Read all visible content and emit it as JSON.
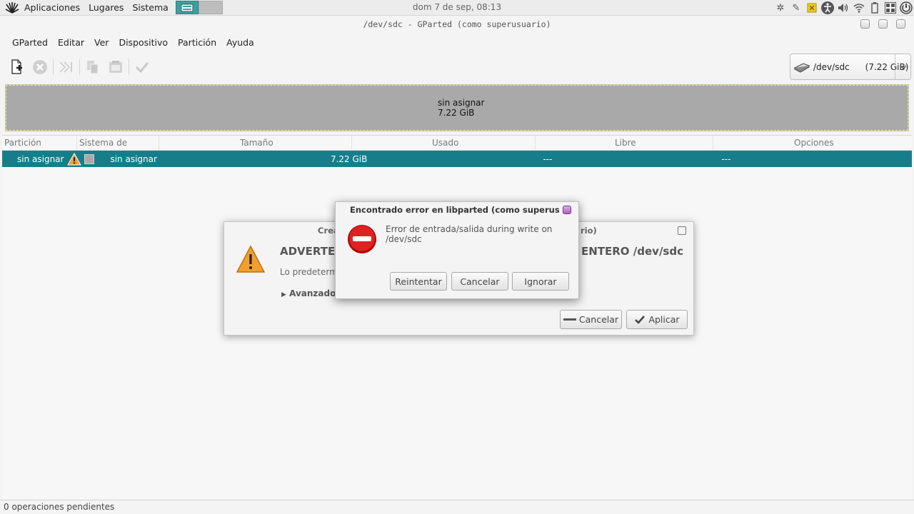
{
  "panel": {
    "menus": [
      "Aplicaciones",
      "Lugares",
      "Sistema"
    ],
    "clock": "dom  7 de sep, 08:13"
  },
  "window": {
    "title": "/dev/sdc - GParted (como superusuario)"
  },
  "menubar": {
    "gparted": "GParted",
    "editar": "Editar",
    "ver": "Ver",
    "dispositivo": "Dispositivo",
    "particion": "Partición",
    "ayuda": "Ayuda"
  },
  "device": {
    "name": "/dev/sdc",
    "size": "(7.22 GiB)"
  },
  "visual": {
    "label": "sin asignar",
    "size": "7.22 GiB"
  },
  "table": {
    "headers": [
      "Partición",
      "Sistema de archivos",
      "Tamaño",
      "Usado",
      "Libre",
      "Opciones"
    ],
    "row": {
      "partition": "sin asignar",
      "filesystem": "sin asignar",
      "size": "7.22 GiB",
      "used": "---",
      "free": "---"
    }
  },
  "status": {
    "text": "0 operaciones pendientes"
  },
  "back_dialog": {
    "title": "Crea",
    "title_end": "rio)",
    "heading": "ADVERTENC",
    "heading_end": "CO ENTERO /dev/sdc",
    "text": "Lo predetermi",
    "advanced": "Avanzado",
    "cancel": "Cancelar",
    "apply": "Aplicar"
  },
  "error_dialog": {
    "title": "Encontrado error en libparted (como superusuario)",
    "message": "Error de entrada/salida during write on /dev/sdc",
    "retry": "Reintentar",
    "cancel": "Cancelar",
    "ignore": "Ignorar"
  },
  "colors": {
    "selection": "#167e8a",
    "unallocated": "#a9a9a9",
    "error_red": "#cc1111",
    "warning_orange": "#f0a030"
  }
}
